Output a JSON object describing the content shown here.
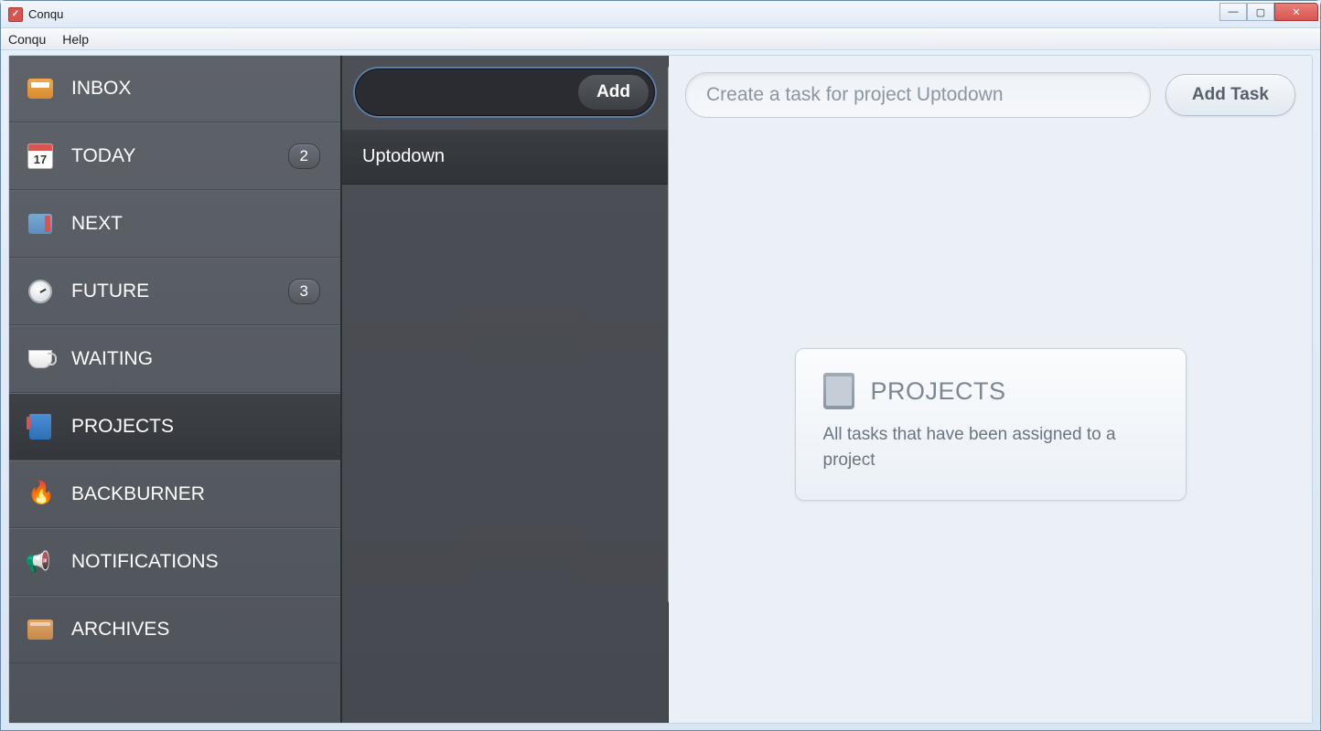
{
  "window": {
    "title": "Conqu"
  },
  "menu": {
    "items": [
      "Conqu",
      "Help"
    ]
  },
  "sidebar": {
    "items": [
      {
        "label": "INBOX",
        "icon": "inbox",
        "badge": null,
        "active": false
      },
      {
        "label": "TODAY",
        "icon": "today",
        "badge": "2",
        "active": false
      },
      {
        "label": "NEXT",
        "icon": "next",
        "badge": null,
        "active": false
      },
      {
        "label": "FUTURE",
        "icon": "future",
        "badge": "3",
        "active": false
      },
      {
        "label": "WAITING",
        "icon": "waiting",
        "badge": null,
        "active": false
      },
      {
        "label": "PROJECTS",
        "icon": "projects",
        "badge": null,
        "active": true
      },
      {
        "label": "BACKBURNER",
        "icon": "backburner",
        "badge": null,
        "active": false
      },
      {
        "label": "NOTIFICATIONS",
        "icon": "notifications",
        "badge": null,
        "active": false
      },
      {
        "label": "ARCHIVES",
        "icon": "archives",
        "badge": null,
        "active": false
      }
    ]
  },
  "middle": {
    "add_label": "Add",
    "projects": [
      {
        "name": "Uptodown"
      }
    ]
  },
  "right": {
    "task_placeholder": "Create a task for project Uptodown",
    "add_task_label": "Add Task",
    "info": {
      "title": "PROJECTS",
      "description": "All tasks that have been assigned to a project"
    }
  }
}
